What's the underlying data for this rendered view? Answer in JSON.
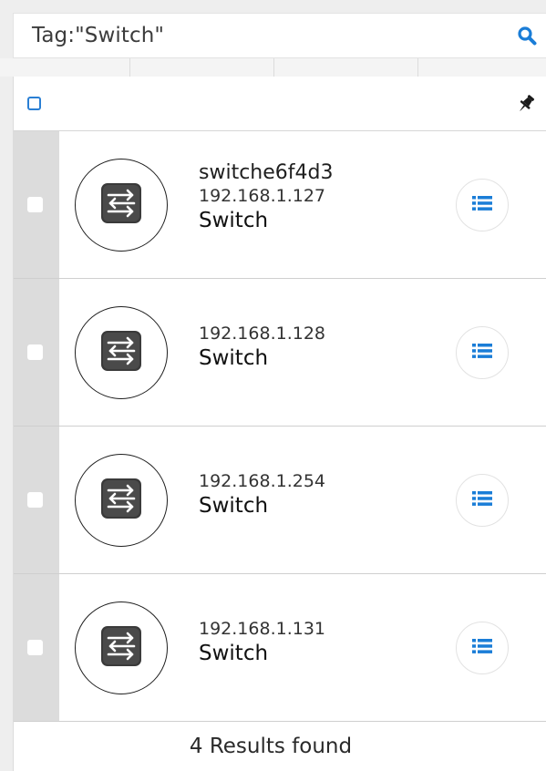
{
  "search": {
    "query": "Tag:\"Switch\""
  },
  "colors": {
    "accent": "#1a7dd7",
    "gutter": "#dcdcdc",
    "checkbox_border": "#2a7fd4"
  },
  "icons": {
    "search": "search-icon",
    "pin": "pin-icon",
    "device": "switch-icon",
    "menu": "list-icon"
  },
  "devices": [
    {
      "name": "switche6f4d3",
      "ip": "192.168.1.127",
      "type": "Switch"
    },
    {
      "name": "",
      "ip": "192.168.1.128",
      "type": "Switch"
    },
    {
      "name": "",
      "ip": "192.168.1.254",
      "type": "Switch"
    },
    {
      "name": "",
      "ip": "192.168.1.131",
      "type": "Switch"
    }
  ],
  "footer": {
    "results": "4 Results found"
  }
}
